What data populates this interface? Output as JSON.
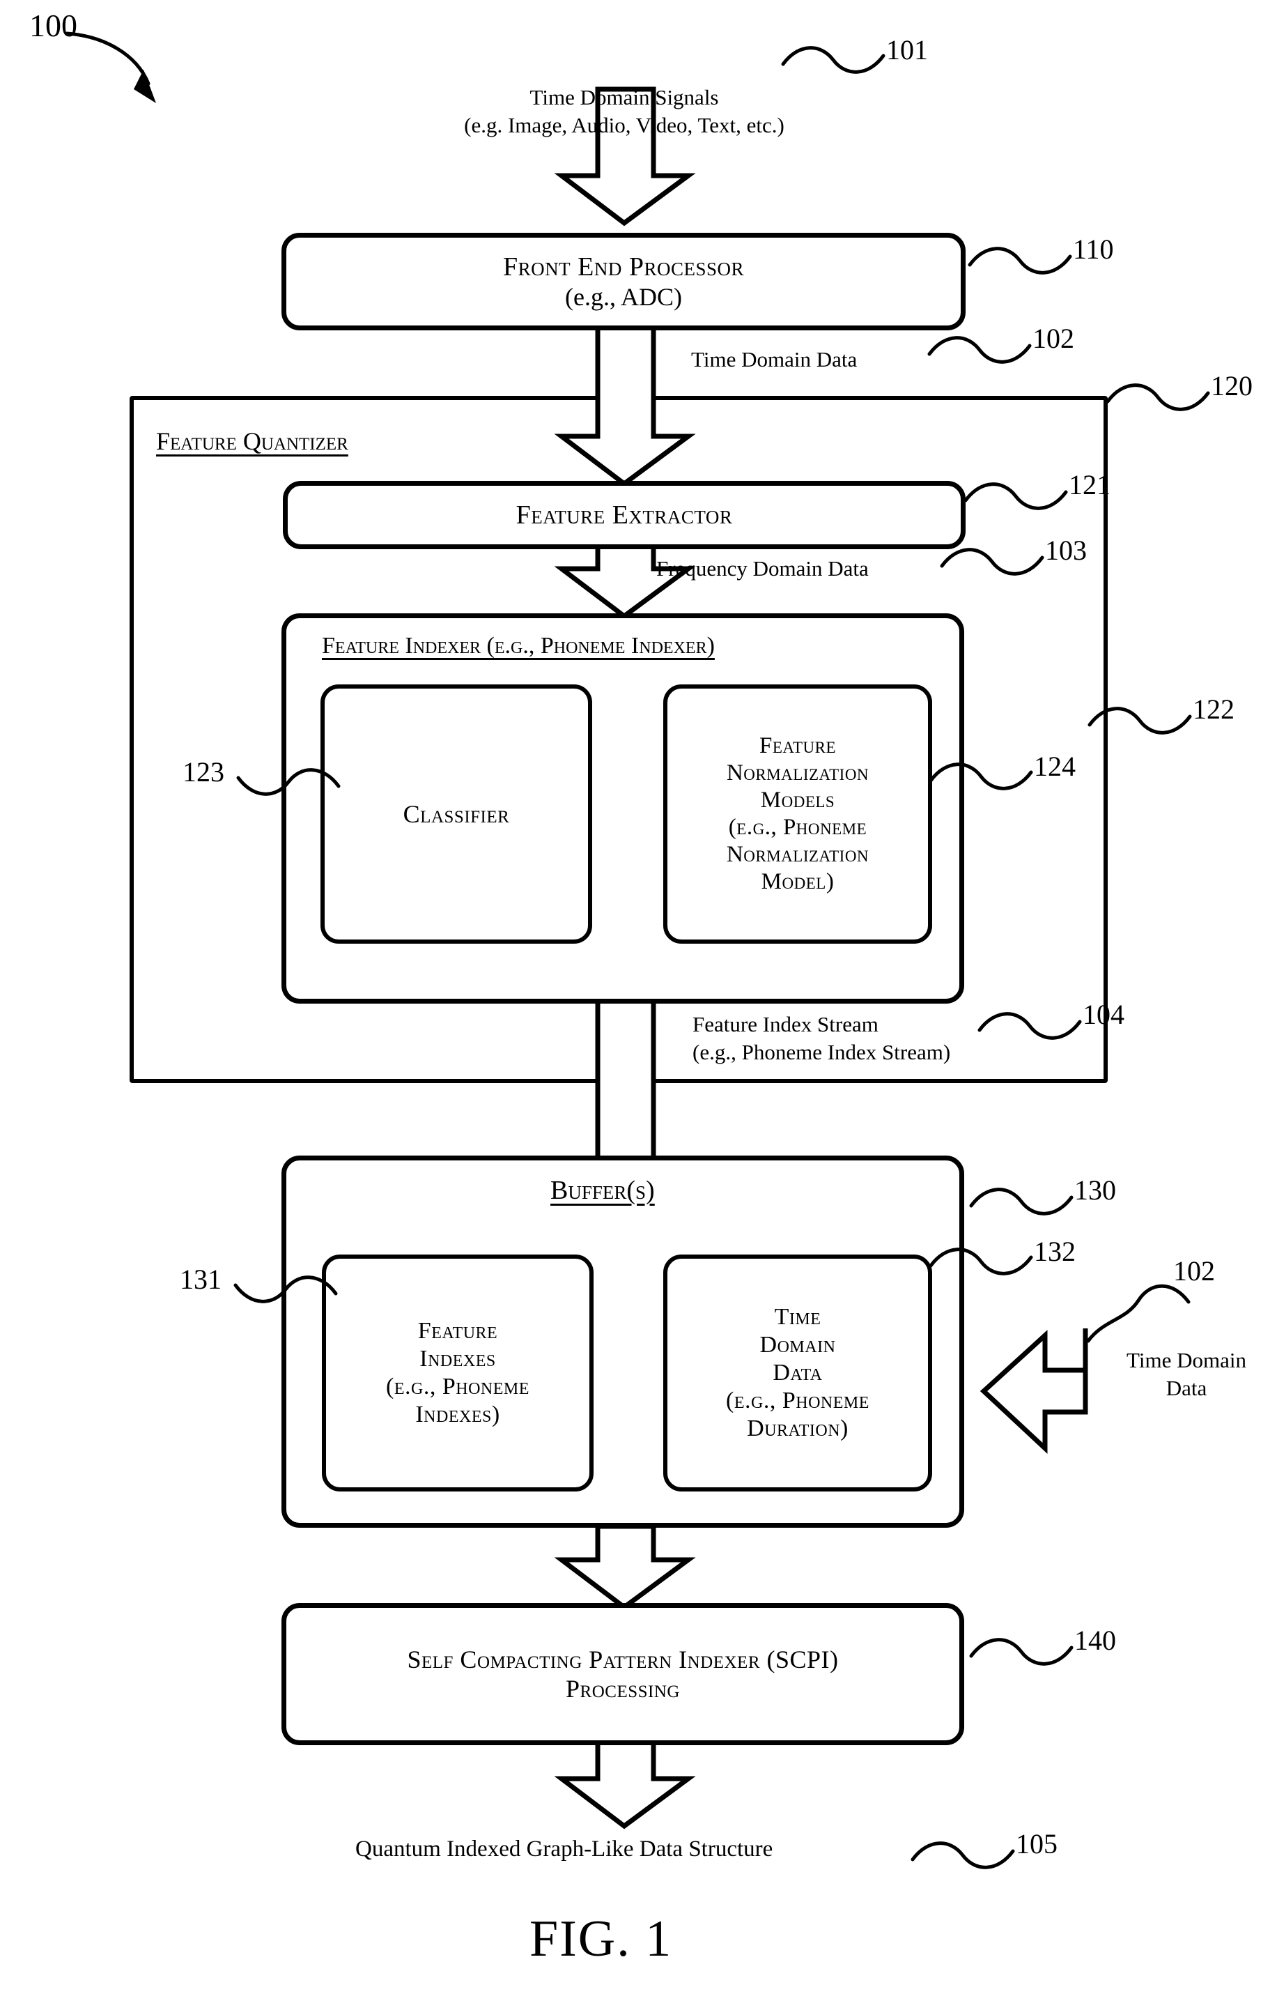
{
  "figure": {
    "label": "FIG. 1",
    "system_ref": "100"
  },
  "nodes": {
    "input_signal": {
      "line1": "Time Domain Signals",
      "line2": "(e.g. Image, Audio, Video, Text, etc.)",
      "ref": "101"
    },
    "front_end_processor": {
      "line1": "Front End Processor",
      "line2": "(e.g., ADC)",
      "ref": "110"
    },
    "time_domain_data": {
      "label": "Time Domain Data",
      "ref": "102"
    },
    "feature_quantizer": {
      "title": "Feature Quantizer",
      "ref": "120"
    },
    "feature_extractor": {
      "label": "Feature Extractor",
      "ref": "121"
    },
    "frequency_domain_data": {
      "label": "Frequency Domain Data",
      "ref": "103"
    },
    "feature_indexer": {
      "title": "Feature Indexer (e.g., Phoneme Indexer)",
      "ref": "122"
    },
    "classifier": {
      "label": "Classifier",
      "ref": "123"
    },
    "feature_normalization_models": {
      "lines": [
        "Feature",
        "Normalization",
        "Models",
        "(e.g., Phoneme",
        "Normalization",
        "Model)"
      ],
      "ref": "124"
    },
    "feature_index_stream": {
      "line1": "Feature Index Stream",
      "line2": "(e.g., Phoneme Index Stream)",
      "ref": "104"
    },
    "buffers": {
      "title": "Buffer(s)",
      "ref": "130"
    },
    "feature_indexes": {
      "lines": [
        "Feature",
        "Indexes",
        "(e.g., Phoneme",
        "Indexes)"
      ],
      "ref": "131"
    },
    "buffer_time_domain_data": {
      "lines": [
        "Time",
        "Domain",
        "Data",
        "(e.g., Phoneme",
        "Duration)"
      ],
      "ref": "132"
    },
    "time_domain_data_feed": {
      "line1": "Time Domain",
      "line2": "Data",
      "ref": "102"
    },
    "scpi": {
      "line1": "Self Compacting Pattern Indexer (SCPI)",
      "line2": "Processing",
      "ref": "140"
    },
    "output": {
      "label": "Quantum Indexed Graph-Like Data Structure",
      "ref": "105"
    }
  },
  "colors": {
    "ink": "#000000",
    "paper": "#ffffff"
  }
}
